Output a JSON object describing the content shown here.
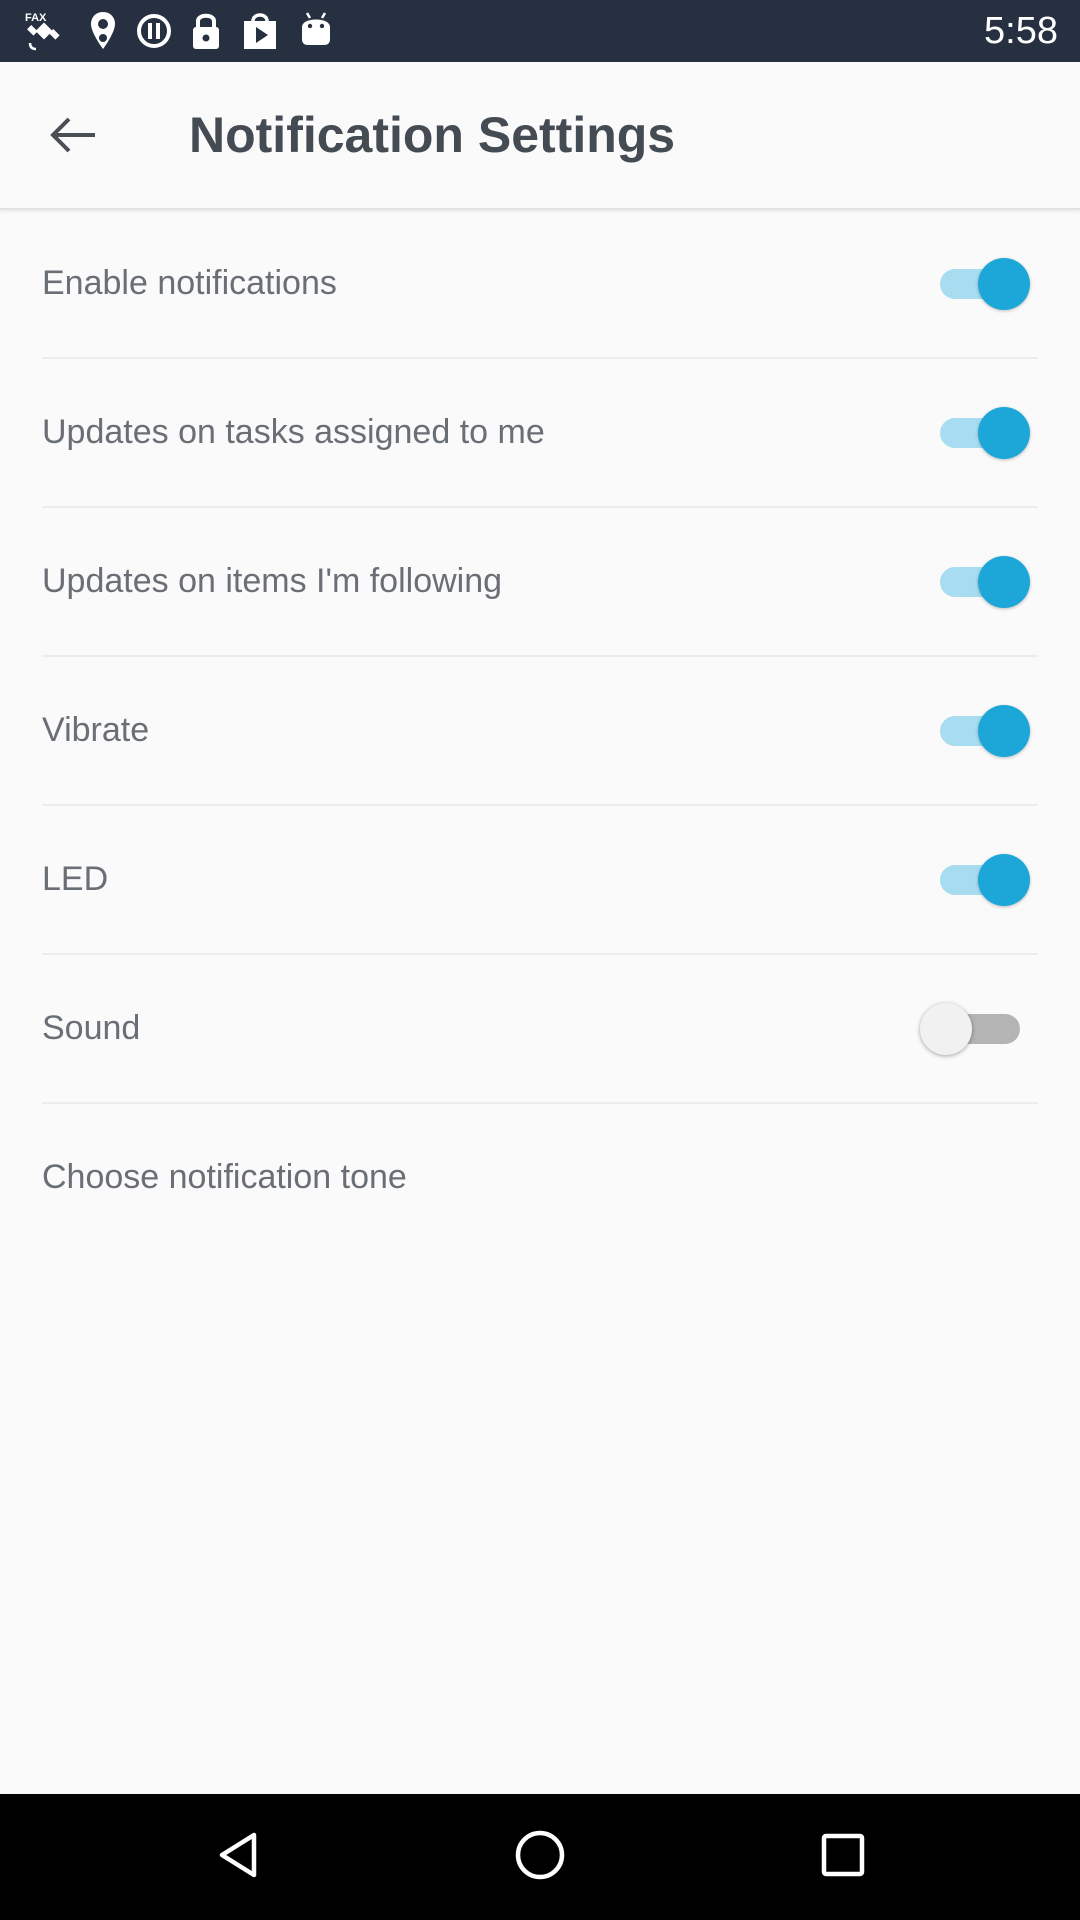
{
  "status_bar": {
    "time": "5:58",
    "icons": [
      "satellite-fax-icon",
      "location-pin-icon",
      "do-not-disturb-icon",
      "lock-icon",
      "play-store-icon",
      "android-icon"
    ]
  },
  "header": {
    "title": "Notification Settings",
    "back_icon": "arrow-left-icon"
  },
  "settings": [
    {
      "label": "Enable notifications",
      "enabled": true
    },
    {
      "label": "Updates on tasks assigned to me",
      "enabled": true
    },
    {
      "label": "Updates on items I'm following",
      "enabled": true
    },
    {
      "label": "Vibrate",
      "enabled": true
    },
    {
      "label": "LED",
      "enabled": true
    },
    {
      "label": "Sound",
      "enabled": false
    },
    {
      "label": "Choose notification tone"
    }
  ],
  "nav_bar": {
    "buttons": [
      "back-triangle-icon",
      "home-circle-icon",
      "recents-square-icon"
    ]
  },
  "colors": {
    "accent": "#1da7d9",
    "status_bar": "#273041",
    "text": "#6a6f75",
    "title": "#444b53"
  }
}
